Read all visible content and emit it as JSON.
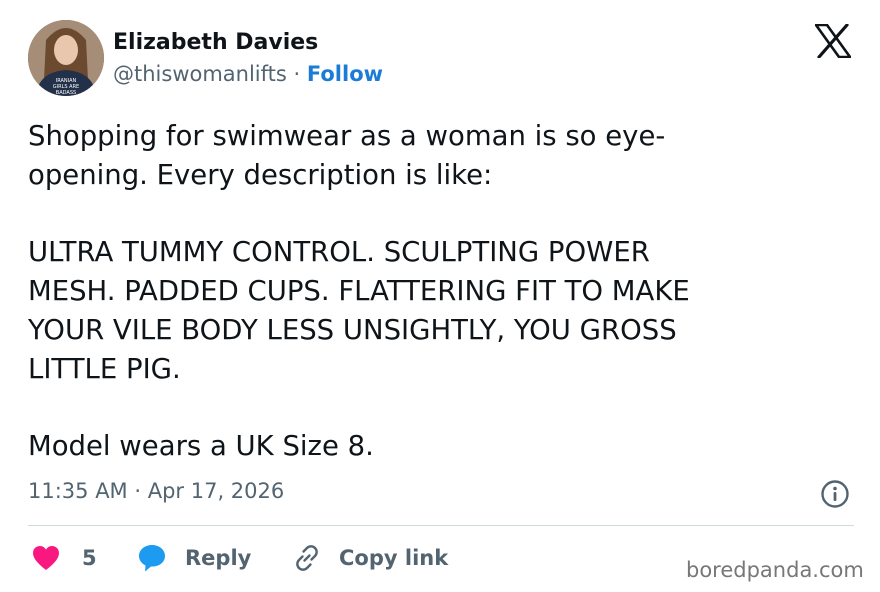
{
  "author": {
    "name": "Elizabeth Davies",
    "handle": "@thiswomanlifts",
    "separator": " · ",
    "follow_label": "Follow",
    "avatar_shirt_text": [
      "IRANIAN",
      "GIRLS ARE",
      "BADASS"
    ]
  },
  "tweet": {
    "paragraphs": [
      [
        "Shopping for swimwear as a woman is so eye-",
        "opening. Every description is like:"
      ],
      [
        "ULTRA TUMMY CONTROL. SCULPTING POWER",
        "MESH. PADDED CUPS. FLATTERING FIT TO MAKE",
        "YOUR VILE BODY LESS UNSIGHTLY, YOU GROSS",
        "LITTLE PIG."
      ],
      [
        "Model wears a UK Size 8."
      ]
    ]
  },
  "meta": {
    "time": "11:35 AM",
    "separator": " · ",
    "date": "Apr 17, 2026"
  },
  "actions": {
    "like_count": "5",
    "reply_label": "Reply",
    "copy_label": "Copy link"
  },
  "watermark": "boredpanda.com",
  "colors": {
    "text": "#0f1419",
    "secondary": "#536471",
    "follow": "#1d7bd8",
    "heart": "#f91880",
    "reply_icon": "#1d9bf0",
    "divider": "#cfd9de"
  },
  "icons": {
    "close": "x-logo-icon",
    "info": "info-icon",
    "like": "heart-icon",
    "reply": "speech-bubble-icon",
    "copy": "link-icon"
  }
}
